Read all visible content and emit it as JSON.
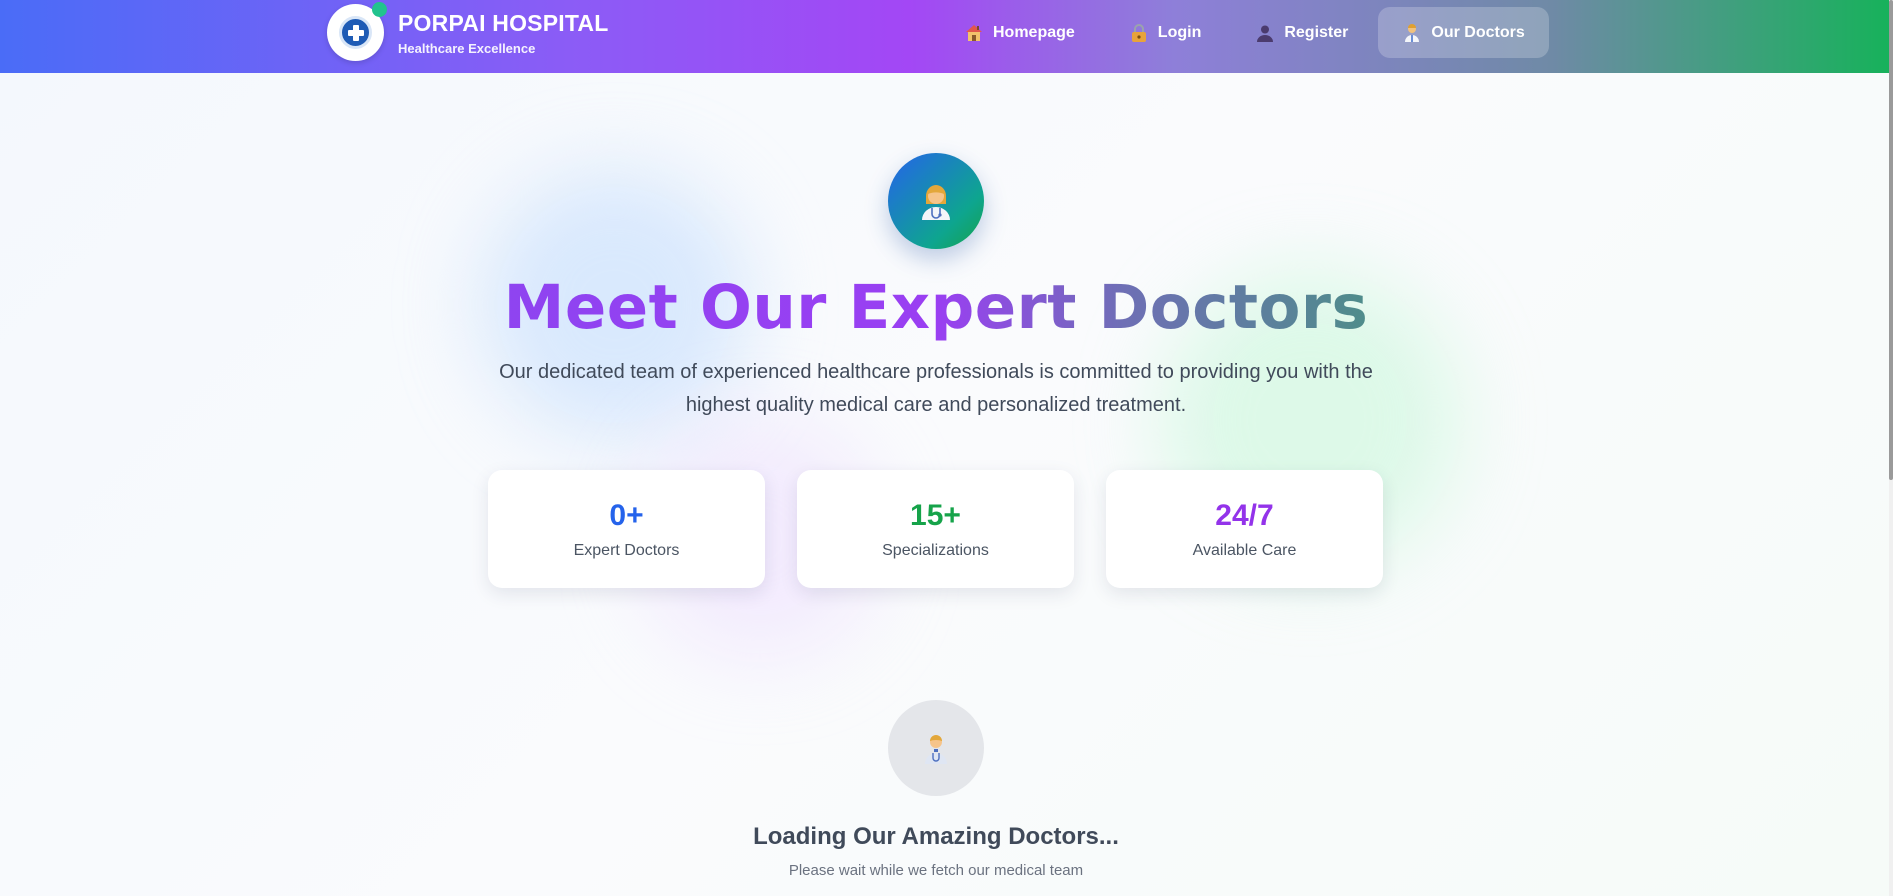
{
  "header": {
    "brand_name": "PORPAI HOSPITAL",
    "brand_tagline": "Healthcare Excellence",
    "nav": [
      {
        "label": "Homepage",
        "icon": "house-icon",
        "active": false
      },
      {
        "label": "Login",
        "icon": "lock-icon",
        "active": false
      },
      {
        "label": "Register",
        "icon": "person-icon",
        "active": false
      },
      {
        "label": "Our Doctors",
        "icon": "doctor-icon",
        "active": true
      }
    ]
  },
  "hero": {
    "icon": "doctor-icon",
    "title": "Meet Our Expert Doctors",
    "subtitle": "Our dedicated team of experienced healthcare professionals is committed to providing you with the highest quality medical care and personalized treatment."
  },
  "stats": [
    {
      "value": "0+",
      "label": "Expert Doctors",
      "color": "#2563eb"
    },
    {
      "value": "15+",
      "label": "Specializations",
      "color": "#16a34a"
    },
    {
      "value": "24/7",
      "label": "Available Care",
      "color": "#9333ea"
    }
  ],
  "loading": {
    "icon": "doctor-icon",
    "title": "Loading Our Amazing Doctors...",
    "subtitle": "Please wait while we fetch our medical team"
  },
  "colors": {
    "header_start": "#4a6cf7",
    "header_mid": "#a347f5",
    "header_end": "#16b25a"
  }
}
